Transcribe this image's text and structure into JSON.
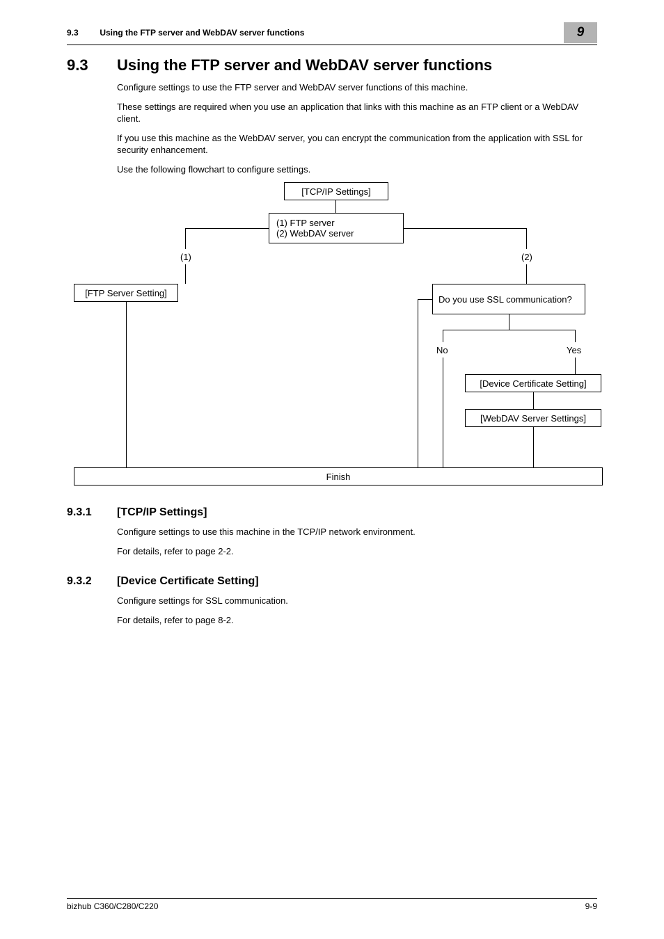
{
  "header": {
    "section_num": "9.3",
    "section_title": "Using the FTP server and WebDAV server functions",
    "chapter": "9"
  },
  "title": {
    "num": "9.3",
    "text": "Using the FTP server and WebDAV server functions"
  },
  "intro": {
    "p1": "Configure settings to use the FTP server and WebDAV server functions of this machine.",
    "p2": "These settings are required when you use an application that links with this machine as an FTP client or a WebDAV client.",
    "p3": "If you use this machine as the WebDAV server, you can encrypt the communication from the application with SSL for security enhancement.",
    "p4": "Use the following flowchart to configure settings."
  },
  "flow": {
    "tcpip": "[TCP/IP Settings]",
    "branch_line1": "(1) FTP server",
    "branch_line2": "(2) WebDAV server",
    "l1": "(1)",
    "l2": "(2)",
    "ftp": "[FTP Server Setting]",
    "ssl_q": "Do you use SSL communication?",
    "no": "No",
    "yes": "Yes",
    "devcert": "[Device Certificate Setting]",
    "webdav": "[WebDAV Server Settings]",
    "finish": "Finish"
  },
  "s1": {
    "num": "9.3.1",
    "title": "[TCP/IP Settings]",
    "p1": "Configure settings to use this machine in the TCP/IP network environment.",
    "p2": "For details, refer to page 2-2."
  },
  "s2": {
    "num": "9.3.2",
    "title": "[Device Certificate Setting]",
    "p1": "Configure settings for SSL communication.",
    "p2": "For details, refer to page 8-2."
  },
  "footer": {
    "left": "bizhub C360/C280/C220",
    "right": "9-9"
  }
}
